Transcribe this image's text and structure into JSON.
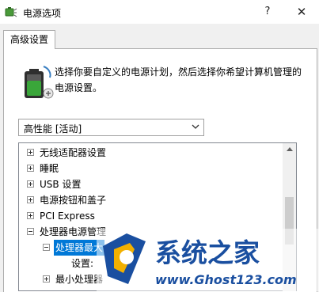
{
  "window": {
    "title": "电源选项",
    "help_label": "?",
    "close_label": "✕"
  },
  "tab": {
    "label": "高级设置"
  },
  "description": "选择你要自定义的电源计划，然后选择你希望计算机管理的电源设置。",
  "plan_select": {
    "value": "高性能 [活动]"
  },
  "tree": {
    "items": [
      {
        "label": "无线适配器设置",
        "expander": "+"
      },
      {
        "label": "睡眠",
        "expander": "+"
      },
      {
        "label": "USB 设置",
        "expander": "+"
      },
      {
        "label": "电源按钮和盖子",
        "expander": "+"
      },
      {
        "label": "PCI Express",
        "expander": "+"
      },
      {
        "label": "处理器电源管理",
        "expander": "−"
      },
      {
        "label": "处理器最大",
        "expander": "−"
      },
      {
        "label": "设置:",
        "expander": ""
      },
      {
        "label": "最小处理器",
        "expander": "+"
      }
    ]
  },
  "watermark": {
    "brand": "系统之家",
    "url": "www.Ghost123.com"
  },
  "colors": {
    "selection": "#0078d7",
    "watermark_blue": "#1a4fa0",
    "battery_green": "#3aa63a"
  }
}
